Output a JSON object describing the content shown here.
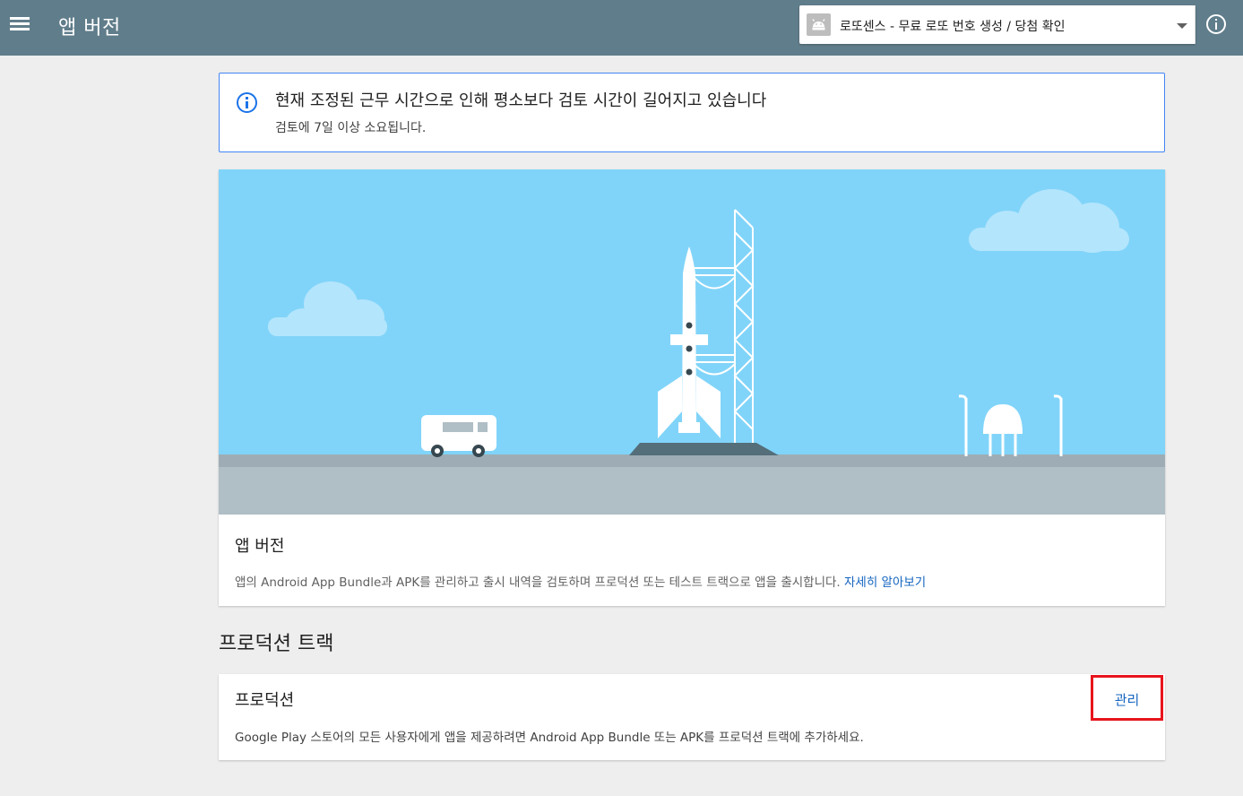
{
  "header": {
    "page_title": "앱 버전",
    "app_selector": {
      "value": "로또센스 - 무료 로또 번호 생성 / 당첨 확인"
    }
  },
  "notice": {
    "title": "현재 조정된 근무 시간으로 인해 평소보다 검토 시간이 길어지고 있습니다",
    "body": "검토에 7일 이상 소요됩니다."
  },
  "intro_card": {
    "title": "앱 버전",
    "description": "앱의 Android App Bundle과 APK를 관리하고 출시 내역을 검토하며 프로덕션 또는 테스트 트랙으로 앱을 출시합니다. ",
    "link_text": "자세히 알아보기"
  },
  "production_section": {
    "heading": "프로덕션 트랙",
    "card": {
      "title": "프로덕션",
      "description": "Google Play 스토어의 모든 사용자에게 앱을 제공하려면 Android App Bundle 또는 APK를 프로덕션 트랙에 추가하세요.",
      "manage_label": "관리"
    }
  },
  "icons": {
    "menu": "menu-icon",
    "app": "android-icon",
    "dropdown": "dropdown-caret-icon",
    "help": "info-icon",
    "notice": "info-icon"
  },
  "colors": {
    "topbar": "#607d8b",
    "accent_link": "#1565c0",
    "notice_border": "#4285f4",
    "highlight_box": "#e8141c",
    "sky": "#81d4f9",
    "ground": "#b0bec5"
  }
}
